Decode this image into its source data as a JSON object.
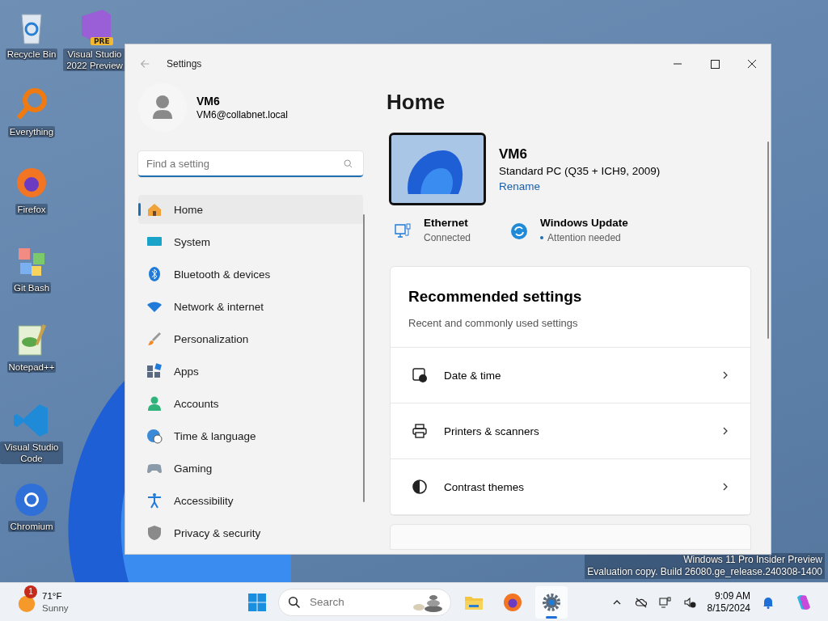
{
  "desktop_icons": [
    {
      "label": "Recycle Bin"
    },
    {
      "label": "Visual Studio 2022 Preview",
      "badge": "PRE"
    },
    {
      "label": "Everything"
    },
    {
      "label": "Firefox"
    },
    {
      "label": "Git Bash"
    },
    {
      "label": "Notepad++"
    },
    {
      "label": "Visual Studio Code"
    },
    {
      "label": "Chromium"
    }
  ],
  "watermark": [
    "Windows 11 Pro Insider Preview",
    "Evaluation copy. Build 26080.ge_release.240308-1400"
  ],
  "window": {
    "title": "Settings",
    "user": {
      "name": "VM6",
      "email": "VM6@collabnet.local"
    },
    "search": {
      "placeholder": "Find a setting"
    },
    "nav": [
      {
        "label": "Home",
        "selected": true
      },
      {
        "label": "System",
        "selected": false
      },
      {
        "label": "Bluetooth & devices",
        "selected": false
      },
      {
        "label": "Network & internet",
        "selected": false
      },
      {
        "label": "Personalization",
        "selected": false
      },
      {
        "label": "Apps",
        "selected": false
      },
      {
        "label": "Accounts",
        "selected": false
      },
      {
        "label": "Time & language",
        "selected": false
      },
      {
        "label": "Gaming",
        "selected": false
      },
      {
        "label": "Accessibility",
        "selected": false
      },
      {
        "label": "Privacy & security",
        "selected": false
      }
    ]
  },
  "main": {
    "heading": "Home",
    "device": {
      "name": "VM6",
      "model": "Standard PC (Q35 + ICH9, 2009)",
      "rename": "Rename"
    },
    "status": [
      {
        "kind": "ethernet",
        "title": "Ethernet",
        "subtitle": "Connected",
        "dot": false
      },
      {
        "kind": "update",
        "title": "Windows Update",
        "subtitle": "Attention needed",
        "dot": true
      }
    ],
    "recommended": {
      "title": "Recommended settings",
      "subtitle": "Recent and commonly used settings",
      "items": [
        {
          "kind": "clock",
          "label": "Date & time"
        },
        {
          "kind": "printer",
          "label": "Printers & scanners"
        },
        {
          "kind": "contrast",
          "label": "Contrast themes"
        }
      ]
    }
  },
  "taskbar": {
    "weather": {
      "badge": "1",
      "temp": "71°F",
      "condition": "Sunny"
    },
    "search": {
      "placeholder": "Search"
    },
    "apps": [
      {
        "kind": "explorer",
        "selected": false
      },
      {
        "kind": "firefox",
        "selected": false
      },
      {
        "kind": "settings",
        "selected": true
      }
    ],
    "clock": {
      "time": "9:09 AM",
      "date": "8/15/2024"
    }
  }
}
